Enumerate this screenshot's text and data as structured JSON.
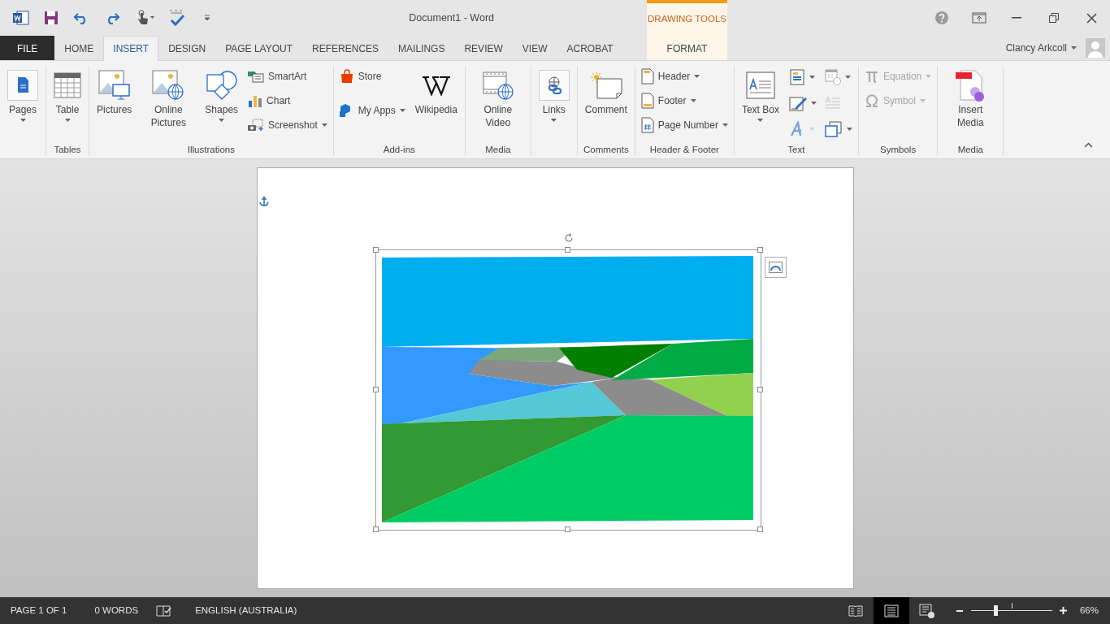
{
  "window": {
    "title": "Document1 - Word",
    "contextual_group": "DRAWING TOOLS",
    "user": "Clancy Arkcoll"
  },
  "tabs": [
    {
      "label": "FILE",
      "kind": "file",
      "selected": false
    },
    {
      "label": "HOME",
      "kind": "normal",
      "selected": false
    },
    {
      "label": "INSERT",
      "kind": "normal",
      "selected": true
    },
    {
      "label": "DESIGN",
      "kind": "normal",
      "selected": false
    },
    {
      "label": "PAGE LAYOUT",
      "kind": "normal",
      "selected": false
    },
    {
      "label": "REFERENCES",
      "kind": "normal",
      "selected": false
    },
    {
      "label": "MAILINGS",
      "kind": "normal",
      "selected": false
    },
    {
      "label": "REVIEW",
      "kind": "normal",
      "selected": false
    },
    {
      "label": "VIEW",
      "kind": "normal",
      "selected": false
    },
    {
      "label": "ACROBAT",
      "kind": "normal",
      "selected": false
    },
    {
      "label": "FORMAT",
      "kind": "contextual",
      "selected": false
    }
  ],
  "ribbon": [
    {
      "items": [
        {
          "kind": "large",
          "label": "Pages",
          "dropdown": true,
          "disabled": false
        }
      ]
    },
    {
      "label": "Tables",
      "items": [
        {
          "kind": "large",
          "label": "Table",
          "dropdown": true,
          "disabled": false
        }
      ]
    },
    {
      "label": "Illustrations",
      "items": [
        {
          "kind": "large",
          "label": "Pictures",
          "dropdown": false,
          "disabled": false
        },
        {
          "kind": "large",
          "label": "Online Pictures",
          "dropdown": false,
          "disabled": false
        },
        {
          "kind": "large",
          "label": "Shapes",
          "dropdown": true,
          "disabled": false
        },
        {
          "kind": "small",
          "label": "SmartArt",
          "dropdown": false,
          "disabled": false
        },
        {
          "kind": "small",
          "label": "Chart",
          "dropdown": false,
          "disabled": false
        },
        {
          "kind": "small",
          "label": "Screenshot",
          "dropdown": true,
          "disabled": false
        }
      ]
    },
    {
      "label": "Add-ins",
      "items": [
        {
          "kind": "small",
          "label": "Store",
          "dropdown": false,
          "disabled": false
        },
        {
          "kind": "small",
          "label": "My Apps",
          "dropdown": true,
          "disabled": false
        },
        {
          "kind": "large",
          "label": "Wikipedia",
          "dropdown": false,
          "disabled": false
        }
      ]
    },
    {
      "label": "Media",
      "items": [
        {
          "kind": "large",
          "label": "Online Video",
          "dropdown": false,
          "disabled": false
        }
      ]
    },
    {
      "items": [
        {
          "kind": "large",
          "label": "Links",
          "dropdown": true,
          "disabled": false
        }
      ]
    },
    {
      "label": "Comments",
      "items": [
        {
          "kind": "large",
          "label": "Comment",
          "dropdown": false,
          "disabled": false
        }
      ]
    },
    {
      "label": "Header & Footer",
      "items": [
        {
          "kind": "small",
          "label": "Header",
          "dropdown": true,
          "disabled": false
        },
        {
          "kind": "small",
          "label": "Footer",
          "dropdown": true,
          "disabled": false
        },
        {
          "kind": "small",
          "label": "Page Number",
          "dropdown": true,
          "disabled": false
        }
      ]
    },
    {
      "label": "Text",
      "items": [
        {
          "kind": "large",
          "label": "Text Box",
          "dropdown": true,
          "disabled": false
        },
        {
          "kind": "icon",
          "dropdown": true,
          "disabled": false
        },
        {
          "kind": "icon",
          "dropdown": true,
          "disabled": false
        },
        {
          "kind": "icon",
          "dropdown": true,
          "disabled": true
        },
        {
          "kind": "icon",
          "dropdown": true,
          "disabled": false
        },
        {
          "kind": "icon",
          "dropdown": false,
          "disabled": true
        },
        {
          "kind": "icon",
          "dropdown": true,
          "disabled": false
        }
      ]
    },
    {
      "label": "Symbols",
      "items": [
        {
          "kind": "small",
          "label": "Equation",
          "dropdown": true,
          "disabled": true
        },
        {
          "kind": "small",
          "label": "Symbol",
          "dropdown": true,
          "disabled": true
        }
      ]
    },
    {
      "label": "Media",
      "items": [
        {
          "kind": "large",
          "label": "Insert Media",
          "dropdown": false,
          "disabled": false
        }
      ]
    }
  ],
  "document": {
    "image": {
      "kind": "picture",
      "selected": true
    }
  },
  "status_bar": {
    "page": "PAGE 1 OF 1",
    "words": "0 WORDS",
    "language": "ENGLISH (AUSTRALIA)",
    "views": [
      {
        "kind": "read",
        "selected": false
      },
      {
        "kind": "print",
        "selected": true
      },
      {
        "kind": "web",
        "selected": false
      }
    ],
    "zoom": {
      "level": 0.3,
      "reading": "66%"
    }
  }
}
